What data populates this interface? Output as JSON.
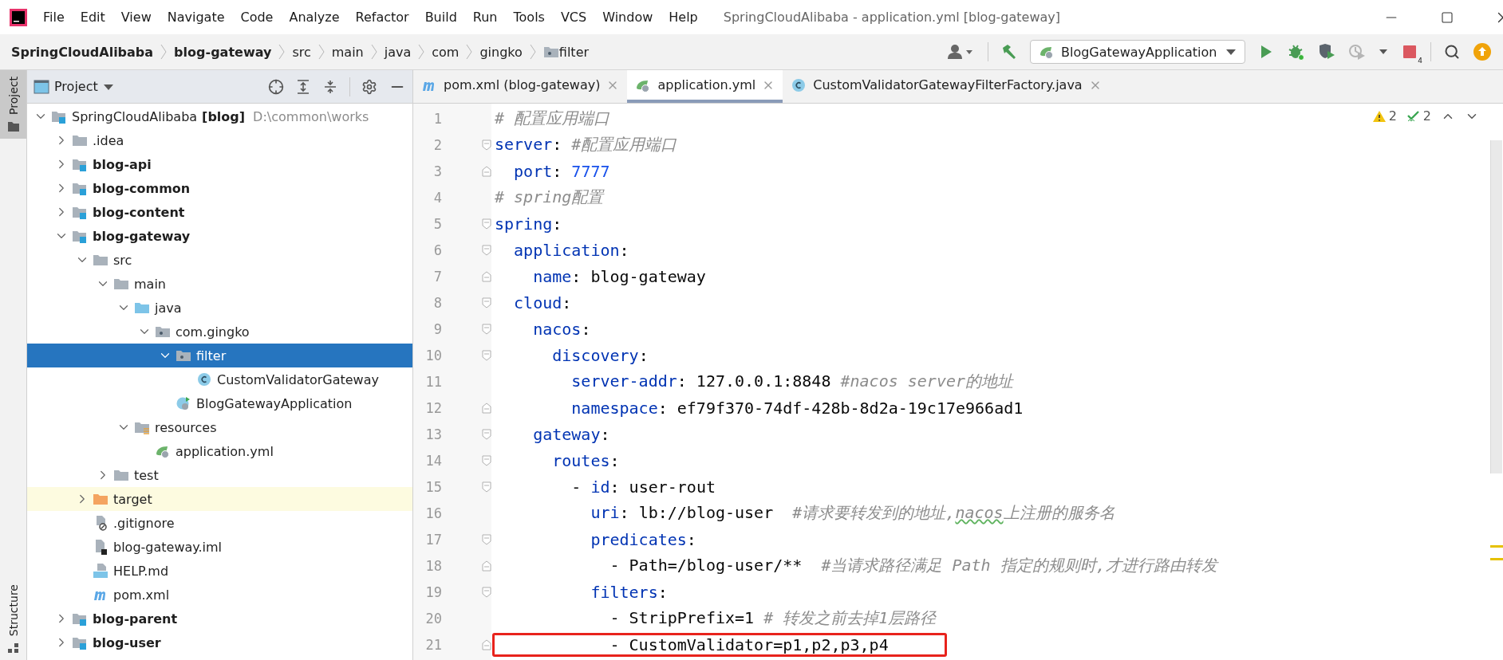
{
  "window": {
    "title": "SpringCloudAlibaba - application.yml [blog-gateway]"
  },
  "menu_bar": {
    "items": [
      "File",
      "Edit",
      "View",
      "Navigate",
      "Code",
      "Analyze",
      "Refactor",
      "Build",
      "Run",
      "Tools",
      "VCS",
      "Window",
      "Help"
    ]
  },
  "breadcrumbs": [
    {
      "label": "SpringCloudAlibaba",
      "bold": true,
      "kind": "text"
    },
    {
      "label": "blog-gateway",
      "bold": true,
      "kind": "text"
    },
    {
      "label": "src",
      "bold": false,
      "kind": "text"
    },
    {
      "label": "main",
      "bold": false,
      "kind": "text"
    },
    {
      "label": "java",
      "bold": false,
      "kind": "text"
    },
    {
      "label": "com",
      "bold": false,
      "kind": "text"
    },
    {
      "label": "gingko",
      "bold": false,
      "kind": "text"
    },
    {
      "label": "filter",
      "bold": false,
      "kind": "folder"
    }
  ],
  "toolbar": {
    "run_configuration": "BlogGatewayApplication",
    "actions": [
      {
        "kind": "run",
        "disabled": false
      },
      {
        "kind": "debug",
        "disabled": false
      },
      {
        "kind": "coverage",
        "disabled": false
      },
      {
        "kind": "profile",
        "disabled": true
      },
      {
        "kind": "stop",
        "disabled": false,
        "badge": "4"
      }
    ]
  },
  "tool_stripe": [
    {
      "label": "Project",
      "selected": true
    },
    {
      "label": "Structure",
      "selected": false
    }
  ],
  "project_panel": {
    "title": "Project",
    "tree": [
      {
        "label": "SpringCloudAlibaba",
        "tag": "[blog]",
        "path": "D:\\common\\works",
        "kind": "module",
        "expanded": true,
        "selected": false,
        "children": [
          {
            "label": ".idea",
            "kind": "folder",
            "bold": false,
            "expanded": false,
            "selected": false
          },
          {
            "label": "blog-api",
            "kind": "module",
            "bold": true,
            "expanded": false,
            "selected": false
          },
          {
            "label": "blog-common",
            "kind": "module",
            "bold": true,
            "expanded": false,
            "selected": false
          },
          {
            "label": "blog-content",
            "kind": "module",
            "bold": true,
            "expanded": false,
            "selected": false
          },
          {
            "label": "blog-gateway",
            "kind": "module",
            "bold": true,
            "expanded": true,
            "selected": false,
            "children": [
              {
                "label": "src",
                "kind": "folder",
                "expanded": true,
                "selected": false,
                "excluded": false,
                "children": [
                  {
                    "label": "main",
                    "kind": "folder",
                    "expanded": true,
                    "selected": false,
                    "children": [
                      {
                        "label": "java",
                        "kind": "source",
                        "expanded": true,
                        "selected": false,
                        "children": [
                          {
                            "label": "com.gingko",
                            "kind": "package",
                            "expanded": true,
                            "selected": false,
                            "children": [
                              {
                                "label": "filter",
                                "kind": "package",
                                "expanded": true,
                                "selected": true,
                                "children": [
                                  {
                                    "label": "CustomValidatorGateway",
                                    "kind": "class",
                                    "selected": false
                                  }
                                ]
                              },
                              {
                                "label": "BlogGatewayApplication",
                                "kind": "application",
                                "selected": false
                              }
                            ]
                          }
                        ]
                      },
                      {
                        "label": "resources",
                        "kind": "resources",
                        "expanded": true,
                        "selected": false,
                        "children": [
                          {
                            "label": "application.yml",
                            "kind": "yml",
                            "selected": false
                          }
                        ]
                      }
                    ]
                  },
                  {
                    "label": "test",
                    "kind": "folder",
                    "expanded": false,
                    "selected": false
                  }
                ]
              },
              {
                "label": "target",
                "kind": "excluded",
                "expanded": false,
                "selected": false,
                "excluded": true
              },
              {
                "label": ".gitignore",
                "kind": "gitignore",
                "selected": false,
                "excluded": false
              },
              {
                "label": "blog-gateway.iml",
                "kind": "iml",
                "selected": false,
                "excluded": false
              },
              {
                "label": "HELP.md",
                "kind": "md",
                "selected": false,
                "excluded": false
              },
              {
                "label": "pom.xml",
                "kind": "maven",
                "selected": false,
                "excluded": false
              }
            ]
          },
          {
            "label": "blog-parent",
            "kind": "module",
            "bold": true,
            "expanded": false,
            "selected": false
          },
          {
            "label": "blog-user",
            "kind": "module",
            "bold": true,
            "expanded": false,
            "selected": false
          }
        ]
      }
    ]
  },
  "tabs": [
    {
      "label": "pom.xml (blog-gateway)",
      "kind": "maven",
      "selected": false
    },
    {
      "label": "application.yml",
      "kind": "yml",
      "selected": true
    },
    {
      "label": "CustomValidatorGatewayFilterFactory.java",
      "kind": "class",
      "selected": false
    }
  ],
  "editor": {
    "inspections": {
      "warnings": "2",
      "typos": "2"
    },
    "lines": [
      {
        "number": "1",
        "kind": "plain",
        "highlighted": false,
        "tokens": [
          {
            "kind": "comment",
            "text": "# 配置应用端口"
          }
        ]
      },
      {
        "number": "2",
        "kind": "open",
        "highlighted": false,
        "tokens": [
          {
            "kind": "key",
            "text": "server"
          },
          {
            "kind": "plain",
            "text": ": "
          },
          {
            "kind": "comment",
            "text": "#配置应用端口"
          }
        ]
      },
      {
        "number": "3",
        "kind": "close",
        "highlighted": false,
        "tokens": [
          {
            "kind": "key",
            "text": "  port"
          },
          {
            "kind": "plain",
            "text": ": "
          },
          {
            "kind": "number",
            "text": "7777"
          }
        ]
      },
      {
        "number": "4",
        "kind": "plain",
        "highlighted": false,
        "tokens": [
          {
            "kind": "comment",
            "text": "# spring配置"
          }
        ]
      },
      {
        "number": "5",
        "kind": "open",
        "highlighted": false,
        "tokens": [
          {
            "kind": "key",
            "text": "spring"
          },
          {
            "kind": "plain",
            "text": ":"
          }
        ]
      },
      {
        "number": "6",
        "kind": "open",
        "highlighted": false,
        "tokens": [
          {
            "kind": "key",
            "text": "  application"
          },
          {
            "kind": "plain",
            "text": ":"
          }
        ]
      },
      {
        "number": "7",
        "kind": "close",
        "highlighted": false,
        "tokens": [
          {
            "kind": "key",
            "text": "    name"
          },
          {
            "kind": "plain",
            "text": ": blog-gateway"
          }
        ]
      },
      {
        "number": "8",
        "kind": "open",
        "highlighted": false,
        "tokens": [
          {
            "kind": "key",
            "text": "  cloud"
          },
          {
            "kind": "plain",
            "text": ":"
          }
        ]
      },
      {
        "number": "9",
        "kind": "open",
        "highlighted": false,
        "tokens": [
          {
            "kind": "key",
            "text": "    nacos"
          },
          {
            "kind": "plain",
            "text": ":"
          }
        ]
      },
      {
        "number": "10",
        "kind": "open",
        "highlighted": false,
        "tokens": [
          {
            "kind": "key",
            "text": "      discovery"
          },
          {
            "kind": "plain",
            "text": ":"
          }
        ]
      },
      {
        "number": "11",
        "kind": "plain",
        "highlighted": false,
        "tokens": [
          {
            "kind": "key",
            "text": "        server-addr"
          },
          {
            "kind": "plain",
            "text": ": 127.0.0.1:8848 "
          },
          {
            "kind": "comment",
            "text": "#nacos server的地址"
          }
        ]
      },
      {
        "number": "12",
        "kind": "close",
        "highlighted": false,
        "tokens": [
          {
            "kind": "key",
            "text": "        namespace"
          },
          {
            "kind": "plain",
            "text": ": ef79f370-74df-428b-8d2a-19c17e966ad1"
          }
        ]
      },
      {
        "number": "13",
        "kind": "open",
        "highlighted": false,
        "tokens": [
          {
            "kind": "key",
            "text": "    gateway"
          },
          {
            "kind": "plain",
            "text": ":"
          }
        ]
      },
      {
        "number": "14",
        "kind": "open",
        "highlighted": false,
        "tokens": [
          {
            "kind": "key",
            "text": "      routes"
          },
          {
            "kind": "plain",
            "text": ":"
          }
        ]
      },
      {
        "number": "15",
        "kind": "open",
        "highlighted": false,
        "tokens": [
          {
            "kind": "plain",
            "text": "        - "
          },
          {
            "kind": "key",
            "text": "id"
          },
          {
            "kind": "plain",
            "text": ": user-rout"
          }
        ]
      },
      {
        "number": "16",
        "kind": "plain",
        "highlighted": false,
        "tokens": [
          {
            "kind": "key",
            "text": "          uri"
          },
          {
            "kind": "plain",
            "text": ": lb://blog-user  "
          },
          {
            "kind": "comment",
            "text": "#请求要转发到的地址,"
          },
          {
            "kind": "typo",
            "text": "nacos"
          },
          {
            "kind": "comment",
            "text": "上注册的服务名"
          }
        ]
      },
      {
        "number": "17",
        "kind": "open",
        "highlighted": false,
        "tokens": [
          {
            "kind": "key",
            "text": "          predicates"
          },
          {
            "kind": "plain",
            "text": ":"
          }
        ]
      },
      {
        "number": "18",
        "kind": "close",
        "highlighted": false,
        "tokens": [
          {
            "kind": "plain",
            "text": "            - Path=/blog-user/**  "
          },
          {
            "kind": "comment",
            "text": "#当请求路径满足 Path 指定的规则时,才进行路由转发"
          }
        ]
      },
      {
        "number": "19",
        "kind": "open",
        "highlighted": false,
        "tokens": [
          {
            "kind": "key",
            "text": "          filters"
          },
          {
            "kind": "plain",
            "text": ":"
          }
        ]
      },
      {
        "number": "20",
        "kind": "plain",
        "highlighted": false,
        "tokens": [
          {
            "kind": "plain",
            "text": "            - StripPrefix=1 "
          },
          {
            "kind": "comment",
            "text": "# 转发之前去掉1层路径"
          }
        ]
      },
      {
        "number": "21",
        "kind": "close",
        "highlighted": true,
        "tokens": [
          {
            "kind": "plain",
            "text": "            - CustomValidator=p1,p2,p3,p4"
          }
        ]
      }
    ]
  }
}
